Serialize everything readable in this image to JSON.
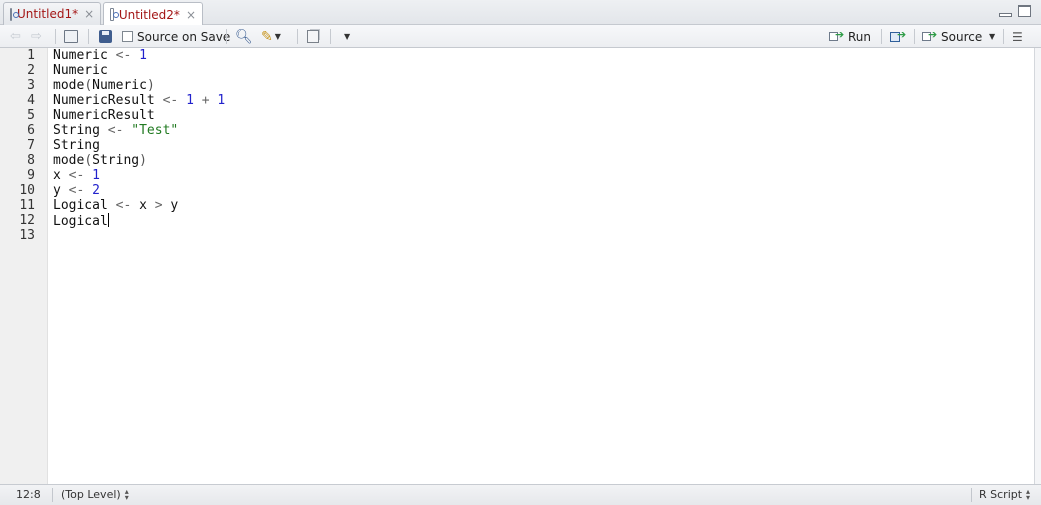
{
  "tabs": [
    {
      "label": "Untitled1*",
      "close": "×",
      "active": false
    },
    {
      "label": "Untitled2*",
      "close": "×",
      "active": true
    }
  ],
  "toolbar": {
    "source_on_save_label": "Source on Save",
    "run_label": "Run",
    "source_label": "Source"
  },
  "editor": {
    "line_numbers": [
      "1",
      "2",
      "3",
      "4",
      "5",
      "6",
      "7",
      "8",
      "9",
      "10",
      "11",
      "12",
      "13"
    ],
    "lines": [
      [
        {
          "t": "Numeric "
        },
        {
          "t": "<-",
          "c": "op"
        },
        {
          "t": " "
        },
        {
          "t": "1",
          "c": "num"
        }
      ],
      [
        {
          "t": "Numeric"
        }
      ],
      [
        {
          "t": "mode"
        },
        {
          "t": "(",
          "c": "paren"
        },
        {
          "t": "Numeric"
        },
        {
          "t": ")",
          "c": "paren"
        }
      ],
      [
        {
          "t": "NumericResult "
        },
        {
          "t": "<-",
          "c": "op"
        },
        {
          "t": " "
        },
        {
          "t": "1",
          "c": "num"
        },
        {
          "t": " "
        },
        {
          "t": "+",
          "c": "op"
        },
        {
          "t": " "
        },
        {
          "t": "1",
          "c": "num"
        }
      ],
      [
        {
          "t": "NumericResult"
        }
      ],
      [
        {
          "t": "String "
        },
        {
          "t": "<-",
          "c": "op"
        },
        {
          "t": " "
        },
        {
          "t": "\"Test\"",
          "c": "str"
        }
      ],
      [
        {
          "t": "String"
        }
      ],
      [
        {
          "t": "mode"
        },
        {
          "t": "(",
          "c": "paren"
        },
        {
          "t": "String"
        },
        {
          "t": ")",
          "c": "paren"
        }
      ],
      [
        {
          "t": "x "
        },
        {
          "t": "<-",
          "c": "op"
        },
        {
          "t": " "
        },
        {
          "t": "1",
          "c": "num"
        }
      ],
      [
        {
          "t": "y "
        },
        {
          "t": "<-",
          "c": "op"
        },
        {
          "t": " "
        },
        {
          "t": "2",
          "c": "num"
        }
      ],
      [
        {
          "t": "Logical "
        },
        {
          "t": "<-",
          "c": "op"
        },
        {
          "t": " x "
        },
        {
          "t": ">",
          "c": "op"
        },
        {
          "t": " y"
        }
      ],
      [
        {
          "t": "Logical"
        }
      ],
      []
    ],
    "cursor_line": 12
  },
  "statusbar": {
    "position": "12:8",
    "scope": "(Top Level)",
    "file_type": "R Script"
  },
  "colors": {
    "number": "#2222cc",
    "string": "#217a21",
    "operator": "#666666",
    "tab_text": "#a31515"
  },
  "icons": [
    "r-document-icon",
    "close-icon",
    "minimize-icon",
    "maximize-icon",
    "back-arrow-icon",
    "forward-arrow-icon",
    "show-in-window-icon",
    "save-icon",
    "search-icon",
    "magic-wand-icon",
    "compile-notebook-icon",
    "run-icon",
    "rerun-icon",
    "source-icon",
    "outline-icon"
  ]
}
